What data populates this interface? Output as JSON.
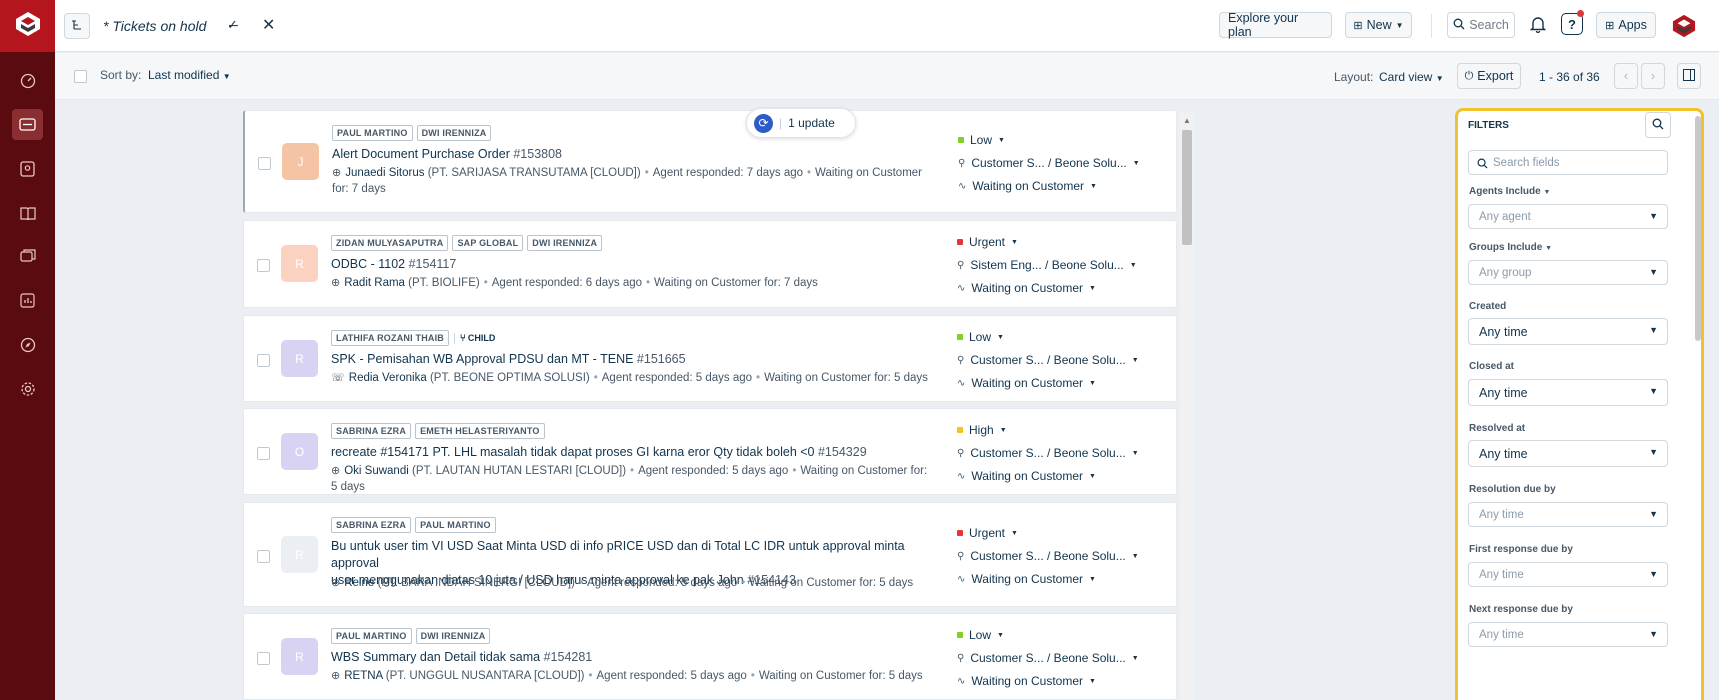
{
  "topbar": {
    "view_title": "* Tickets on hold",
    "explore_label": "Explore your plan",
    "new_label": "New",
    "search_label": "Search",
    "help_label": "?",
    "apps_label": "Apps"
  },
  "subbar": {
    "sort_prefix": "Sort by:",
    "sort_value": "Last modified",
    "layout_prefix": "Layout:",
    "layout_value": "Card view",
    "export_label": "Export",
    "pagination": "1 - 36 of 36"
  },
  "update_pill": {
    "label": "1 update"
  },
  "tickets": [
    {
      "avatar": "J",
      "avatar_color": "#f5c4a4",
      "tags": [
        "PAUL MARTINO",
        "DWI IRENNIZA"
      ],
      "subject": "Alert Document Purchase Order",
      "id": "#153808",
      "requester": "Junaedi Sitorus",
      "company": "(PT. SARIJASA TRANSUTAMA [CLOUD])",
      "responded": "Agent responded: 7 days ago",
      "waiting": "Waiting on Customer for: 7",
      "waiting_wrap": "days",
      "priority": "Low",
      "priority_color": "#7ed321",
      "group": "Customer S... / Beone Solu...",
      "status": "Waiting on Customer"
    },
    {
      "avatar": "R",
      "avatar_color": "#fbd2bf",
      "tags": [
        "ZIDAN MULYASAPUTRA",
        "SAP GLOBAL",
        "DWI IRENNIZA"
      ],
      "subject": "ODBC - 1102",
      "id": "#154117",
      "requester": "Radit Rama",
      "company": "(PT. BIOLIFE)",
      "responded": "Agent responded: 6 days ago",
      "waiting": "Waiting on Customer for: 7 days",
      "priority": "Urgent",
      "priority_color": "#e43538",
      "group": "Sistem Eng... / Beone Solu...",
      "status": "Waiting on Customer"
    },
    {
      "avatar": "R",
      "avatar_color": "#d8d3f3",
      "tags": [
        "LATHIFA ROZANI THAIB"
      ],
      "child_label": "CHILD",
      "subject": "SPK - Pemisahan WB Approval PDSU dan MT - TENE",
      "id": "#151665",
      "requester": "Redia Veronika",
      "company": "(PT. BEONE OPTIMA SOLUSI)",
      "responded": "Agent responded: 5 days ago",
      "waiting": "Waiting on Customer for: 5 days",
      "priority": "Low",
      "priority_color": "#7ed321",
      "group": "Customer S... / Beone Solu...",
      "status": "Waiting on Customer"
    },
    {
      "avatar": "O",
      "avatar_color": "#d8d3f3",
      "tags": [
        "SABRINA EZRA",
        "EMETH HELASTERIYANTO"
      ],
      "subject": "recreate #154171 PT. LHL masalah tidak dapat proses GI karna eror Qty tidak boleh <0",
      "id": "#154329",
      "requester": "Oki Suwandi",
      "company": "(PT. LAUTAN HUTAN LESTARI [CLOUD])",
      "responded": "Agent responded: 5 days ago",
      "waiting": "Waiting on Customer for: 5 days",
      "priority": "High",
      "priority_color": "#f5c518",
      "group": "Customer S... / Beone Solu...",
      "status": "Waiting on Customer"
    },
    {
      "avatar": "R",
      "avatar_color": "#ebeff3",
      "tags": [
        "SABRINA EZRA",
        "PAUL MARTINO"
      ],
      "subject": "Bu untuk user tim VI USD Saat Minta USD di info pRICE USD dan di Total LC IDR untuk approval minta approval",
      "subject_line2": "user menggunakan diatas 10 juta / USD harus minta approval ke pak John",
      "id": "#154143",
      "requester": "Reine",
      "company": "(PT. BARA INDAH SINERGI [CLOUD])",
      "responded": "Agent responded: 5 days ago",
      "waiting": "Waiting on Customer for: 5 days",
      "priority": "Urgent",
      "priority_color": "#e43538",
      "group": "Customer S... / Beone Solu...",
      "status": "Waiting on Customer"
    },
    {
      "avatar": "R",
      "avatar_color": "#d8d3f3",
      "tags": [
        "PAUL MARTINO",
        "DWI IRENNIZA"
      ],
      "subject": "WBS Summary dan Detail tidak sama",
      "id": "#154281",
      "requester": "RETNA",
      "company": "(PT. UNGGUL NUSANTARA [CLOUD])",
      "responded": "Agent responded: 5 days ago",
      "waiting": "Waiting on Customer for: 5 days",
      "priority": "Low",
      "priority_color": "#7ed321",
      "group": "Customer S... / Beone Solu...",
      "status": "Waiting on Customer"
    }
  ],
  "filters": {
    "title": "FILTERS",
    "search_placeholder": "Search fields",
    "agents_label": "Agents Include",
    "agents_value": "Any agent",
    "groups_label": "Groups Include",
    "groups_value": "Any group",
    "created_label": "Created",
    "created_value": "Any time",
    "closed_label": "Closed at",
    "closed_value": "Any time",
    "resolved_label": "Resolved at",
    "resolved_value": "Any time",
    "resolution_due_label": "Resolution due by",
    "resolution_due_value": "Any time",
    "first_response_label": "First response due by",
    "first_response_value": "Any time",
    "next_response_label": "Next response due by",
    "next_response_value": "Any time"
  },
  "colors": {
    "sidebar": "#590b0f",
    "logo_bg": "#b5151c",
    "highlight": "#f2c12e",
    "update_icon": "#2c5cc5"
  },
  "icons": [
    "logo-icon",
    "dashboard-icon",
    "tickets-icon",
    "contacts-icon",
    "solutions-icon",
    "forums-icon",
    "reports-icon",
    "discovery-icon",
    "settings-icon",
    "filter-toggle-icon",
    "check-icon",
    "close-icon",
    "bell-icon",
    "help-icon",
    "apps-icon",
    "export-icon",
    "prev-icon",
    "next-icon",
    "panel-icon",
    "globe-icon",
    "phone-icon",
    "agent-icon",
    "status-icon",
    "search-icon",
    "sync-icon"
  ]
}
